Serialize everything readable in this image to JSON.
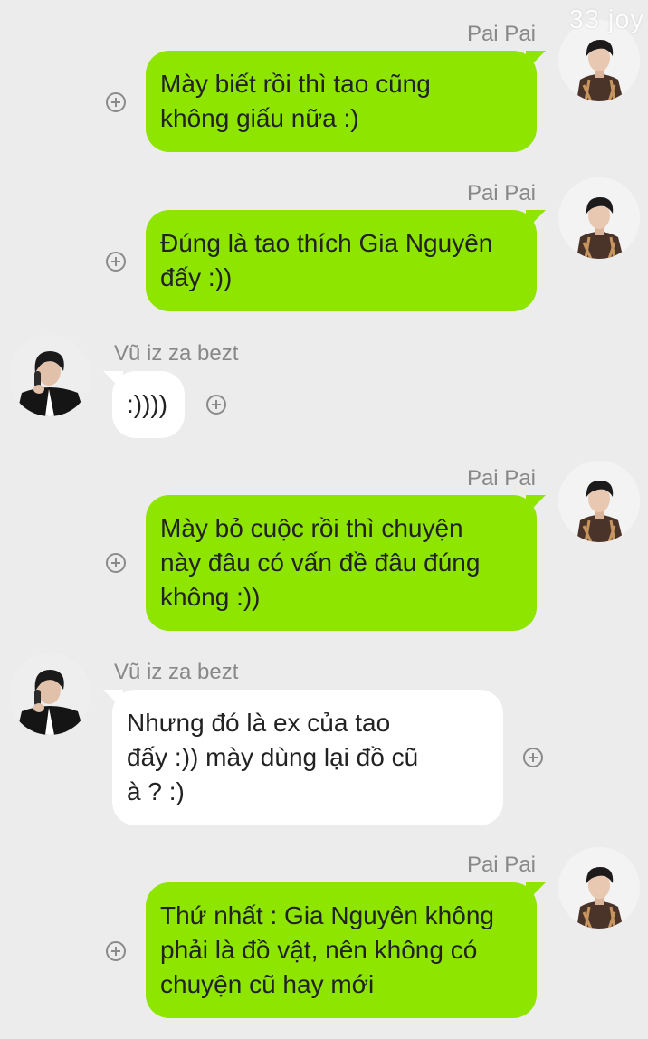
{
  "watermark": "33 joy",
  "contacts": {
    "me": "Pai Pai",
    "other": "Vũ iz za bezt"
  },
  "messages": [
    {
      "sender": "Pai Pai",
      "side": "right",
      "lines": [
        "Mày biết rồi thì tao cũng",
        "không giấu nữa :)"
      ]
    },
    {
      "sender": "Pai Pai",
      "side": "right",
      "lines": [
        "Đúng là tao thích Gia Nguyên",
        "đấy :))"
      ]
    },
    {
      "sender": "Vũ iz za bezt",
      "side": "left",
      "lines": [
        ":))))"
      ]
    },
    {
      "sender": "Pai Pai",
      "side": "right",
      "lines": [
        "Mày bỏ cuộc rồi thì chuyện",
        "này đâu có vấn đề đâu đúng",
        "không :))"
      ]
    },
    {
      "sender": "Vũ iz za bezt",
      "side": "left",
      "lines": [
        "Nhưng đó là ex của tao",
        "đấy :)) mày dùng lại đồ cũ",
        "à ? :)"
      ]
    },
    {
      "sender": "Pai Pai",
      "side": "right",
      "lines": [
        "Thứ nhất : Gia Nguyên không",
        "phải là đồ vật, nên không có",
        "chuyện cũ hay mới"
      ]
    }
  ],
  "icons": {
    "add": "plus-circle-icon",
    "avatar_me": "avatar-pai-pai",
    "avatar_other": "avatar-vu"
  },
  "colors": {
    "background": "#ececec",
    "my_bubble": "#8ee500",
    "other_bubble": "#ffffff",
    "name_text": "#888888"
  }
}
